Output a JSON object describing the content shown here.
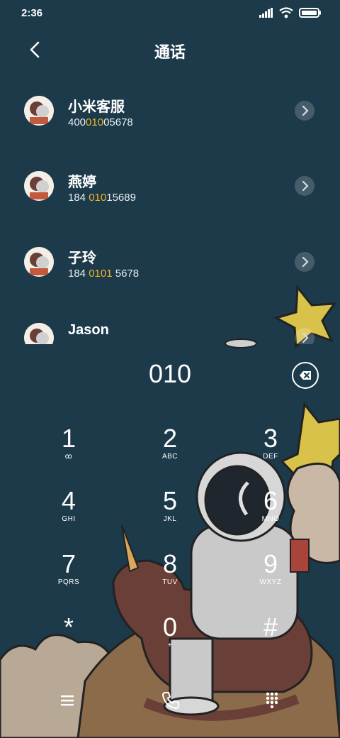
{
  "status": {
    "time": "2:36"
  },
  "header": {
    "title": "通话"
  },
  "contacts": [
    {
      "name": "小米客服",
      "number_pre": "400",
      "number_hl": "010",
      "number_post": "05678"
    },
    {
      "name": "燕婷",
      "number_pre": "184 ",
      "number_hl": "010",
      "number_post": "15689"
    },
    {
      "name": "子玲",
      "number_pre": "184 ",
      "number_hl": "0101",
      "number_post": " 5678"
    },
    {
      "name": "Jason",
      "number_pre": "",
      "number_hl": "",
      "number_post": ""
    }
  ],
  "dialer": {
    "input": "010",
    "keys": [
      {
        "digit": "1",
        "letters": "ꝏ"
      },
      {
        "digit": "2",
        "letters": "ABC"
      },
      {
        "digit": "3",
        "letters": "DEF"
      },
      {
        "digit": "4",
        "letters": "GHI"
      },
      {
        "digit": "5",
        "letters": "JKL"
      },
      {
        "digit": "6",
        "letters": "MNO"
      },
      {
        "digit": "7",
        "letters": "PQRS"
      },
      {
        "digit": "8",
        "letters": "TUV"
      },
      {
        "digit": "9",
        "letters": "WXYZ"
      },
      {
        "digit": "*",
        "letters": ""
      },
      {
        "digit": "0",
        "letters": "+"
      },
      {
        "digit": "#",
        "letters": ""
      }
    ]
  },
  "colors": {
    "background": "#1d3a4b",
    "highlight": "#f1b52a",
    "accent_call": "#ffffff"
  },
  "icons": {
    "back": "chevron-left-icon",
    "delete": "backspace-icon",
    "menu": "menu-icon",
    "call": "phone-icon",
    "keypad": "keypad-icon"
  }
}
